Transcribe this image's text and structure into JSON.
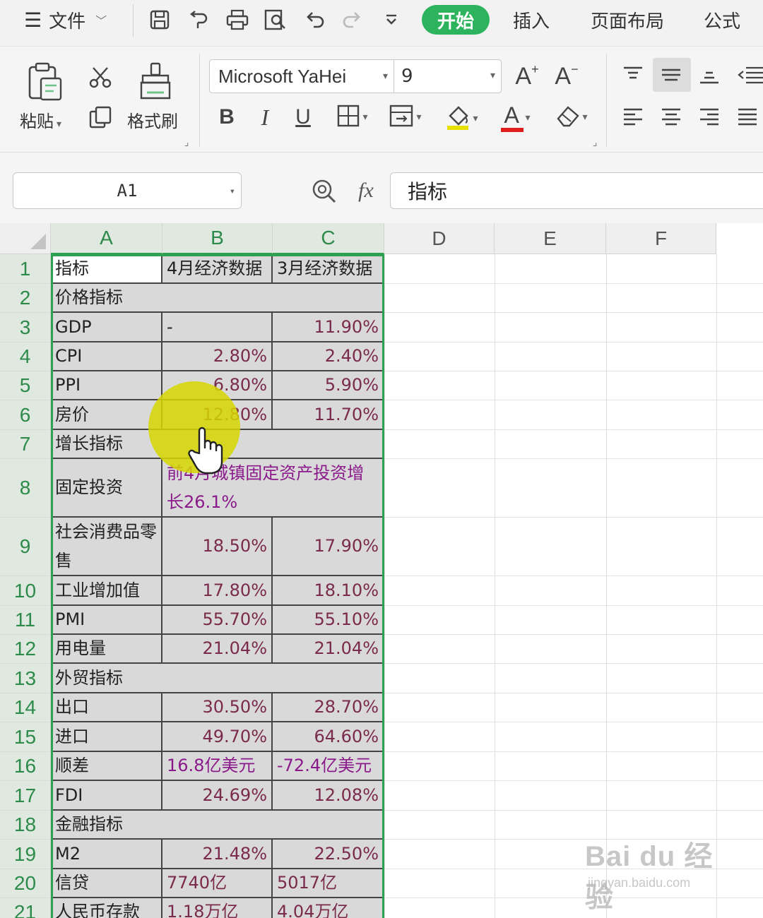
{
  "menu": {
    "file_label": "文件",
    "tabs": [
      "开始",
      "插入",
      "页面布局",
      "公式"
    ]
  },
  "ribbon": {
    "paste_label": "粘贴",
    "format_painter_label": "格式刷",
    "font_name": "Microsoft YaHei",
    "font_size": "9",
    "bold": "B",
    "italic": "I",
    "underline": "U",
    "grow_font": "A",
    "shrink_font": "A",
    "font_color_glyph": "A",
    "font_color": "#e02020",
    "fill_color": "#e8e000"
  },
  "formula_bar": {
    "name_box": "A1",
    "fx_label": "fx",
    "formula": "指标"
  },
  "sheet": {
    "columns": [
      "A",
      "B",
      "C",
      "D",
      "E",
      "F"
    ],
    "rows": [
      {
        "num": "1",
        "a": "指标",
        "b": "4月经济数据",
        "c": "3月经济数据"
      },
      {
        "num": "2",
        "a": "价格指标",
        "b": "",
        "c": ""
      },
      {
        "num": "3",
        "a": "GDP",
        "b": "-",
        "c": "11.90%"
      },
      {
        "num": "4",
        "a": "CPI",
        "b": "2.80%",
        "c": "2.40%"
      },
      {
        "num": "5",
        "a": "PPI",
        "b": "6.80%",
        "c": "5.90%"
      },
      {
        "num": "6",
        "a": "房价",
        "b": "12.80%",
        "c": "11.70%"
      },
      {
        "num": "7",
        "a": "增长指标",
        "b": "",
        "c": ""
      },
      {
        "num": "8",
        "a": "固定投资",
        "bc": "前4月城镇固定资产投资增长26.1%"
      },
      {
        "num": "9",
        "a": "社会消费品零售",
        "b": "18.50%",
        "c": "17.90%"
      },
      {
        "num": "10",
        "a": "工业增加值",
        "b": "17.80%",
        "c": "18.10%"
      },
      {
        "num": "11",
        "a": "PMI",
        "b": "55.70%",
        "c": "55.10%"
      },
      {
        "num": "12",
        "a": "用电量",
        "b": "21.04%",
        "c": "21.04%"
      },
      {
        "num": "13",
        "a": "外贸指标",
        "b": "",
        "c": ""
      },
      {
        "num": "14",
        "a": "出口",
        "b": "30.50%",
        "c": "28.70%"
      },
      {
        "num": "15",
        "a": "进口",
        "b": "49.70%",
        "c": "64.60%"
      },
      {
        "num": "16",
        "a": "顺差",
        "b": "16.8亿美元",
        "c": "-72.4亿美元"
      },
      {
        "num": "17",
        "a": "FDI",
        "b": "24.69%",
        "c": "12.08%"
      },
      {
        "num": "18",
        "a": "金融指标",
        "b": "",
        "c": ""
      },
      {
        "num": "19",
        "a": "M2",
        "b": "21.48%",
        "c": "22.50%"
      },
      {
        "num": "20",
        "a": "信贷",
        "b": "7740亿",
        "c": "5017亿"
      },
      {
        "num": "21",
        "a": "人民币存款",
        "b": "1.18万亿",
        "c": "4.04万亿"
      }
    ],
    "accent_color": "#2ea052"
  },
  "watermark": {
    "main": "Bai du 经验",
    "sub": "jingyan.baidu.com"
  }
}
